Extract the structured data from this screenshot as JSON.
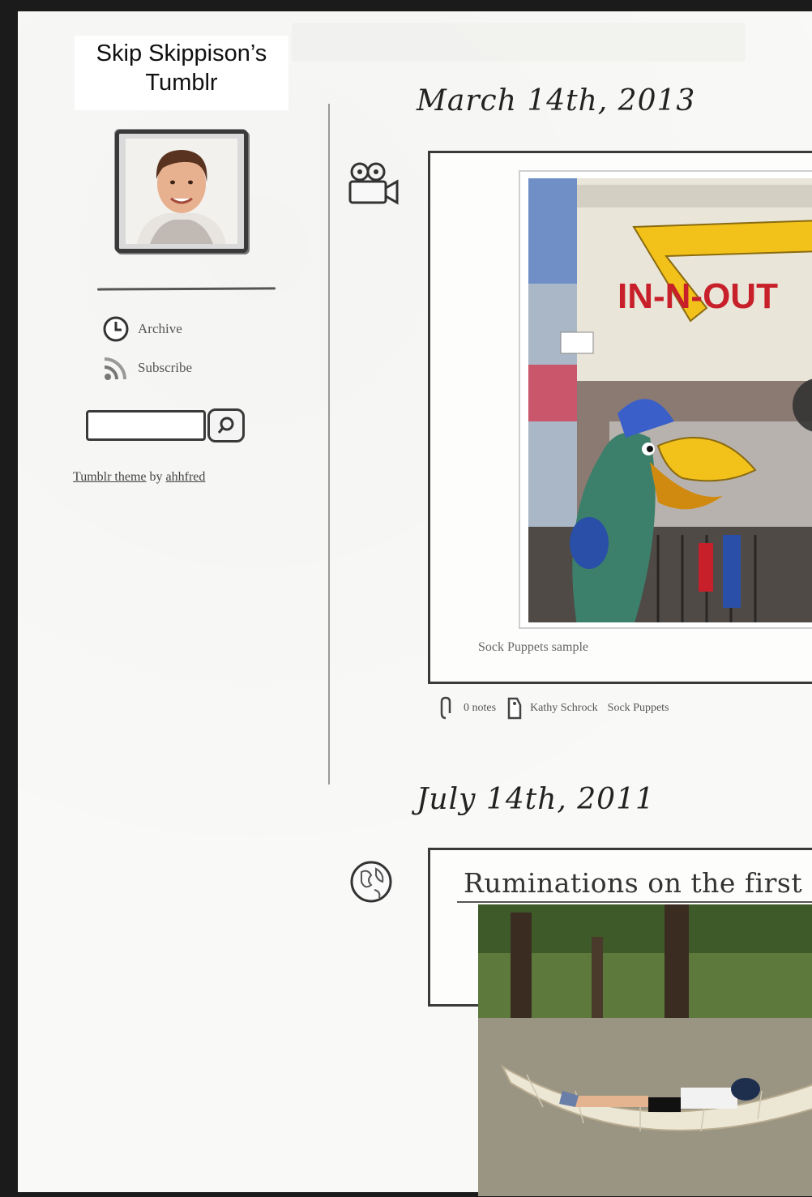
{
  "blog": {
    "title_line1": "Skip Skippison’s",
    "title_line2": "Tumblr"
  },
  "sidebar": {
    "links": [
      {
        "label": "Archive",
        "icon": "clock-icon"
      },
      {
        "label": "Subscribe",
        "icon": "rss-icon"
      }
    ],
    "search": {
      "value": "",
      "placeholder": ""
    },
    "credit": {
      "theme_link": "Tumblr theme",
      "by": "by",
      "author_link": "ahhfred"
    }
  },
  "posts": [
    {
      "date": "March 14th, 2013",
      "type_icon": "video-camera-icon",
      "video_sign": "IN-N-OUT",
      "caption": "Sock Puppets sample",
      "notes": "0 notes",
      "tags": [
        "Kathy Schrock",
        "Sock Puppets"
      ]
    },
    {
      "date": "July 14th, 2011",
      "type_icon": "globe-icon",
      "title": "Ruminations on the first"
    }
  ],
  "colors": {
    "frame": "#1b1b1b",
    "paper": "#f9f9f7",
    "sign_red": "#c8202a",
    "arrow_yellow": "#f2c21a"
  }
}
